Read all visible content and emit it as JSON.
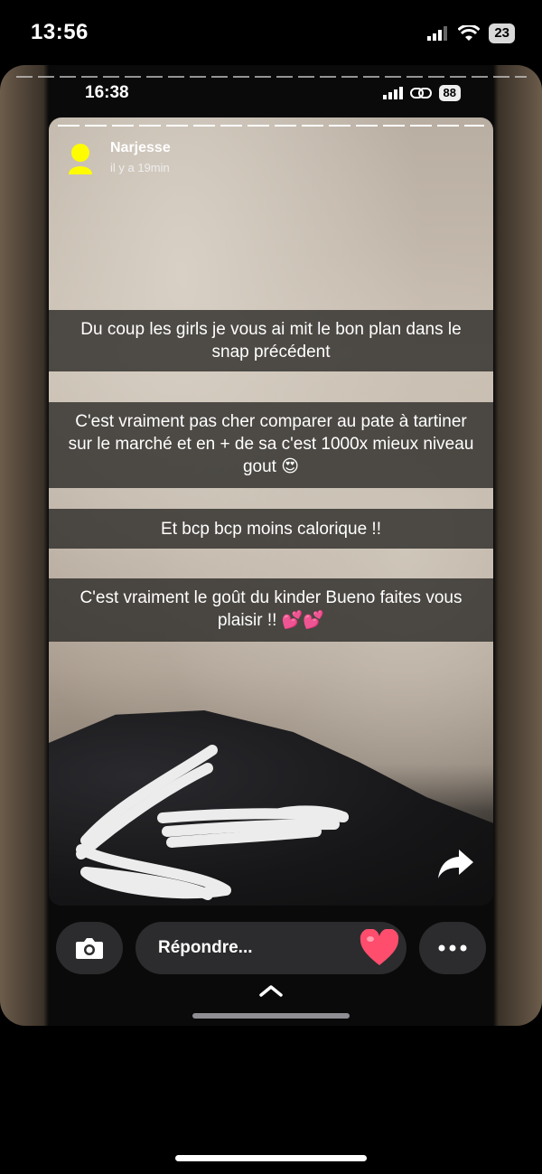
{
  "outer_status": {
    "time": "13:56",
    "battery": "23",
    "icons": [
      "location-arrow-icon",
      "signal-icon",
      "wifi-icon",
      "battery-icon"
    ]
  },
  "inner_status": {
    "time": "16:38",
    "battery": "88",
    "icons": [
      "location-arrow-icon",
      "signal-icon",
      "link-icon",
      "battery-icon"
    ]
  },
  "story": {
    "username": "Narjesse",
    "time_ago": "il y a 19min",
    "captions": [
      "Du coup les girls je vous ai mit le bon plan dans le snap précédent",
      "C'est vraiment pas cher comparer au pate à tartiner sur le marché et en + de sa c'est 1000x mieux niveau gout 😍",
      "Et bcp bcp moins calorique !!",
      "C'est vraiment le goût du kinder Bueno faites vous plaisir !! 💕💕"
    ]
  },
  "bottom_bar": {
    "reply_placeholder": "Répondre...",
    "icons": [
      "camera-icon",
      "heart-icon",
      "more-icon",
      "chevron-up-icon",
      "share-arrow-icon"
    ]
  },
  "colors": {
    "pill_bg": "#2c2c2e",
    "caption_bg": "rgba(40,38,36,0.78)",
    "heart": "#ff4d6d"
  }
}
